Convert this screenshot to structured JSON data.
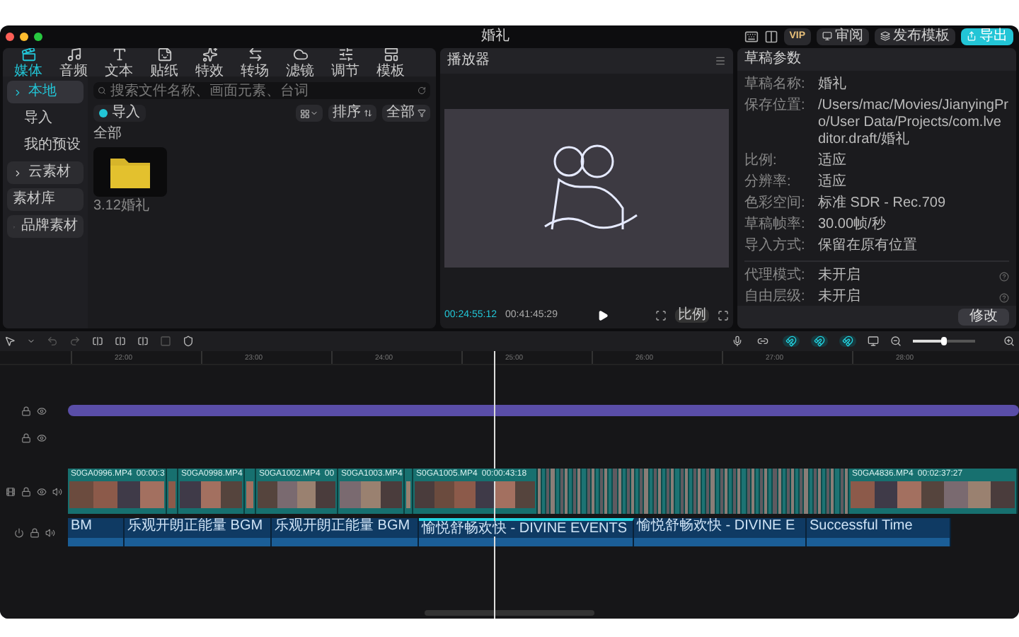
{
  "window": {
    "title": "婚礼"
  },
  "top_actions": {
    "vip": "VIP",
    "buttons": [
      "审阅",
      "发布模板"
    ],
    "export": "导出"
  },
  "media_tabs": [
    {
      "label": "媒体",
      "selected": true
    },
    {
      "label": "音频",
      "selected": false
    },
    {
      "label": "文本",
      "selected": false
    },
    {
      "label": "贴纸",
      "selected": false
    },
    {
      "label": "特效",
      "selected": false
    },
    {
      "label": "转场",
      "selected": false
    },
    {
      "label": "滤镜",
      "selected": false
    },
    {
      "label": "调节",
      "selected": false
    },
    {
      "label": "模板",
      "selected": false
    }
  ],
  "media_sidebar": [
    {
      "label": "本地",
      "kind": "group",
      "selected": true,
      "expandable": true
    },
    {
      "label": "导入",
      "kind": "sub",
      "selected": false,
      "expandable": false
    },
    {
      "label": "我的预设",
      "kind": "sub",
      "selected": false,
      "expandable": false
    },
    {
      "label": "云素材",
      "kind": "group",
      "selected": false,
      "expandable": true
    },
    {
      "label": "素材库",
      "kind": "group",
      "selected": false,
      "expandable": false
    },
    {
      "label": "品牌素材",
      "kind": "group",
      "selected": false,
      "expandable": true
    }
  ],
  "media": {
    "search_placeholder": "搜索文件名称、画面元素、台词",
    "import": "导入",
    "sort": "排序",
    "filter": "全部",
    "section": "全部",
    "items": [
      {
        "name": "3.12婚礼"
      }
    ]
  },
  "player": {
    "title": "播放器",
    "current": "00:24:55:12",
    "total": "00:41:45:29",
    "ratio": "比例"
  },
  "draft": {
    "title": "草稿参数",
    "fields": [
      {
        "label": "草稿名称:",
        "value": "婚礼"
      },
      {
        "label": "保存位置:",
        "value": "/Users/mac/Movies/JianyingPro/User Data/Projects/com.lveditor.draft/婚礼"
      },
      {
        "label": "比例:",
        "value": "适应"
      },
      {
        "label": "分辨率:",
        "value": "适应"
      },
      {
        "label": "色彩空间:",
        "value": "标准 SDR - Rec.709"
      },
      {
        "label": "草稿帧率:",
        "value": "30.00帧/秒"
      },
      {
        "label": "导入方式:",
        "value": "保留在原有位置"
      }
    ],
    "settings": [
      {
        "label": "代理模式:",
        "value": "未开启"
      },
      {
        "label": "自由层级:",
        "value": "未开启"
      }
    ],
    "button": "修改"
  },
  "timeline": {
    "toggles": [
      {
        "on": false
      },
      {
        "on": true
      },
      {
        "on": true
      },
      {
        "on": true
      }
    ],
    "zoom": {
      "level": 0.45
    },
    "ruler": [
      "22:00",
      "23:00",
      "24:00",
      "25:00",
      "26:00",
      "27:00",
      "28:00"
    ],
    "tracks": [
      {
        "kind": "text"
      },
      {
        "kind": "empty"
      },
      {
        "kind": "video",
        "clips": [
          {
            "kind": "clip",
            "name": "S0GA0996.MP4",
            "duration": "00:00:3"
          },
          {
            "kind": "short"
          },
          {
            "kind": "clip",
            "name": "S0GA0998.MP4"
          },
          {
            "kind": "short"
          },
          {
            "kind": "clip",
            "name": "S0GA1002.MP4",
            "duration": "00"
          },
          {
            "kind": "clip",
            "name": "S0GA1003.MP4"
          },
          {
            "kind": "short"
          },
          {
            "kind": "clip",
            "name": "S0GA1005.MP4",
            "duration": "00:00:43:18"
          },
          {
            "kind": "dense"
          },
          {
            "kind": "clip",
            "name": "S0GA4836.MP4",
            "duration": "00:02:37:27"
          }
        ]
      },
      {
        "kind": "audio",
        "clips": [
          {
            "label": "BM",
            "selected": false
          },
          {
            "label": "乐观开朗正能量 BGM",
            "selected": false
          },
          {
            "label": "乐观开朗正能量 BGM",
            "selected": false
          },
          {
            "label": "愉悦舒畅欢快 - DIVINE EVENTS",
            "selected": true
          },
          {
            "label": "愉悦舒畅欢快 - DIVINE E",
            "selected": false
          },
          {
            "label": "Successful Time",
            "selected": false
          }
        ]
      }
    ]
  }
}
